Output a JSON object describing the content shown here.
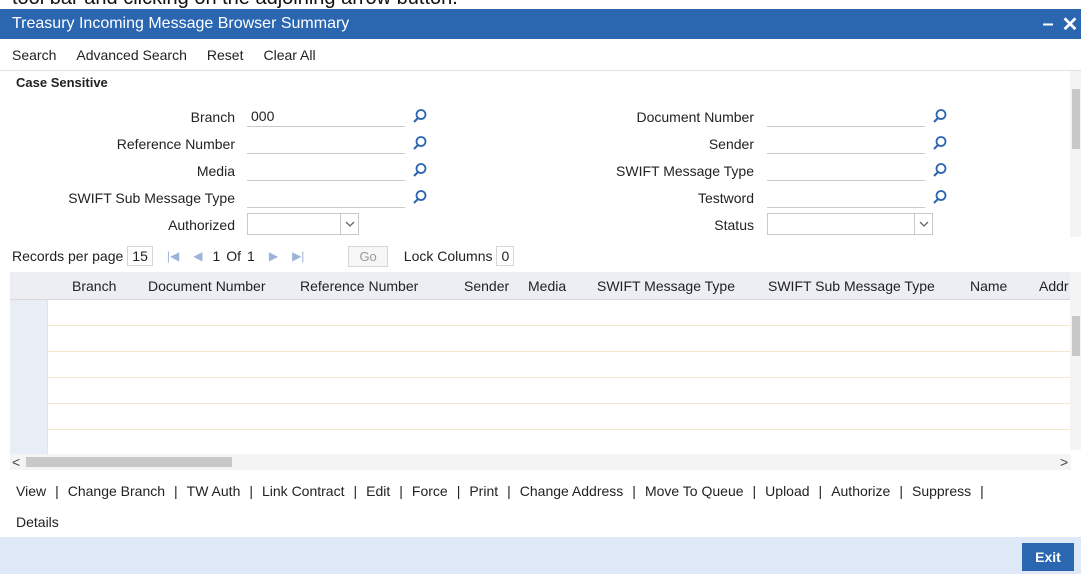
{
  "clipped_caption": "tool bar and clicking on the adjoining arrow button.",
  "window": {
    "title": "Treasury Incoming Message Browser Summary",
    "minimize": "–",
    "close": "✕"
  },
  "menu": {
    "items": [
      "Search",
      "Advanced Search",
      "Reset",
      "Clear All"
    ]
  },
  "form": {
    "section": "Case Sensitive",
    "left": [
      {
        "label": "Branch",
        "value": "000",
        "type": "search"
      },
      {
        "label": "Reference Number",
        "value": "",
        "type": "search"
      },
      {
        "label": "Media",
        "value": "",
        "type": "search"
      },
      {
        "label": "SWIFT Sub Message Type",
        "value": "",
        "type": "search"
      },
      {
        "label": "Authorized",
        "value": "",
        "type": "select"
      }
    ],
    "right": [
      {
        "label": "Document Number",
        "value": "",
        "type": "search"
      },
      {
        "label": "Sender",
        "value": "",
        "type": "search"
      },
      {
        "label": "SWIFT Message Type",
        "value": "",
        "type": "search"
      },
      {
        "label": "Testword",
        "value": "",
        "type": "search"
      },
      {
        "label": "Status",
        "value": "",
        "type": "select"
      }
    ]
  },
  "pager": {
    "records_label": "Records per page",
    "records_value": "15",
    "page": "1",
    "of_label": "Of",
    "total": "1",
    "go": "Go",
    "lock_label": "Lock Columns",
    "lock_value": "0"
  },
  "grid": {
    "columns": [
      "Branch",
      "Document Number",
      "Reference Number",
      "Sender",
      "Media",
      "SWIFT Message Type",
      "SWIFT Sub Message Type",
      "Name",
      "Addr"
    ],
    "rows": [
      {},
      {},
      {},
      {},
      {},
      {}
    ]
  },
  "actions": {
    "row1": [
      "View",
      "Change Branch",
      "TW Auth",
      "Link Contract",
      "Edit",
      "Force",
      "Print",
      "Change Address",
      "Move To Queue",
      "Upload",
      "Authorize",
      "Suppress"
    ],
    "row2": [
      "Details"
    ]
  },
  "footer": {
    "exit": "Exit"
  },
  "colors": {
    "titlebar": "#2b66b1",
    "footer": "#dfe8f6",
    "grid_header": "#eceef3",
    "exit_button": "#2b66b1"
  },
  "icons": {
    "search": "magnifier-icon",
    "dropdown": "chevron-down-icon"
  }
}
